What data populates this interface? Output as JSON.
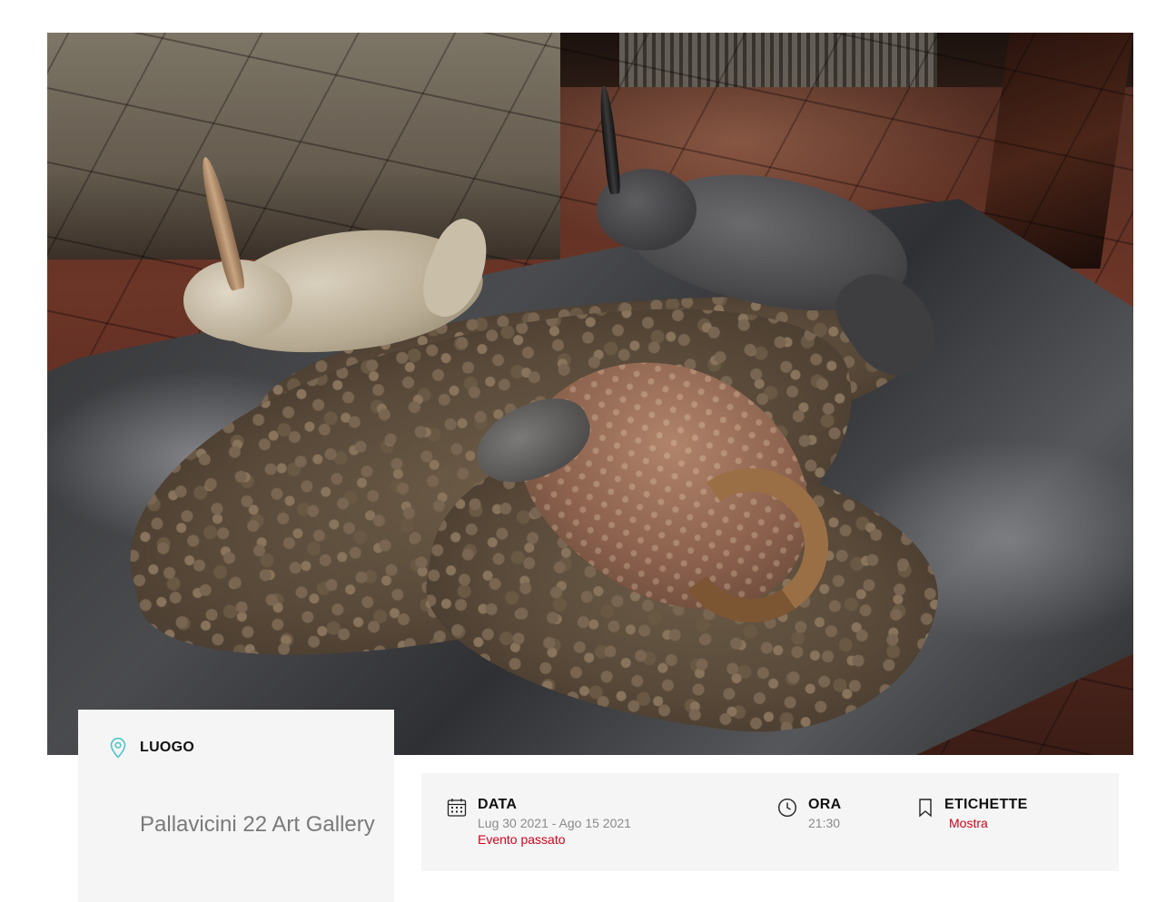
{
  "hero": {
    "alt": "Sculpture installation photo"
  },
  "location": {
    "heading": "LUOGO",
    "name": "Pallavicini 22 Art Gallery",
    "icon": "map-pin-icon",
    "accent": "#4ec3c9"
  },
  "details": {
    "date": {
      "heading": "DATA",
      "value": "Lug 30 2021 - Ago 15 2021",
      "status": "Evento passato",
      "icon": "calendar-icon"
    },
    "time": {
      "heading": "ORA",
      "value": "21:30",
      "icon": "clock-icon"
    },
    "tags": {
      "heading": "ETICHETTE",
      "value": "Mostra",
      "icon": "bookmark-icon"
    }
  },
  "colors": {
    "status_red": "#d0021b",
    "muted_text": "#8a8a8a",
    "panel_bg": "#f5f5f5"
  }
}
